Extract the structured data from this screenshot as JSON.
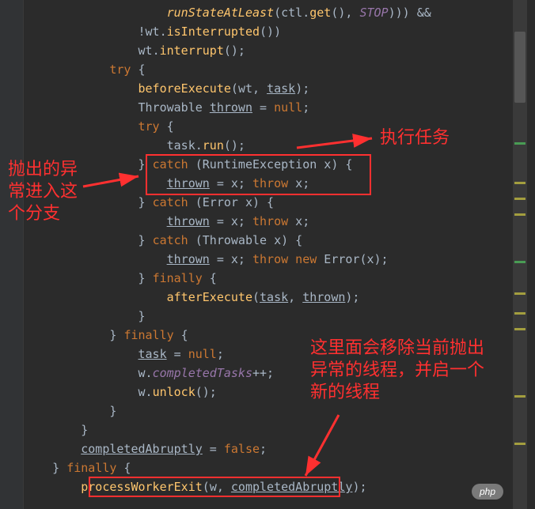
{
  "code": {
    "l0": "                    runStateAtLeast(ctl.get(), STOP))) &&",
    "l1": "                !wt.isInterrupted())",
    "l2": "                wt.interrupt();",
    "l3": "            try {",
    "l4": "                beforeExecute(wt, task);",
    "l5": "                Throwable thrown = null;",
    "l6": "                try {",
    "l7": "                    task.run();",
    "l8": "                } catch (RuntimeException x) {",
    "l9": "                    thrown = x; throw x;",
    "l10": "                } catch (Error x) {",
    "l11": "                    thrown = x; throw x;",
    "l12": "                } catch (Throwable x) {",
    "l13": "                    thrown = x; throw new Error(x);",
    "l14": "                } finally {",
    "l15": "                    afterExecute(task, thrown);",
    "l16": "                }",
    "l17": "            } finally {",
    "l18": "                task = null;",
    "l19": "                w.completedTasks++;",
    "l20": "                w.unlock();",
    "l21": "            }",
    "l22": "        }",
    "l23": "        completedAbruptly = false;",
    "l24": "    } finally {",
    "l25": "        processWorkerExit(w, completedAbruptly);"
  },
  "annotations": {
    "left": "抛出的异常进入这个分支",
    "topRight": "执行任务",
    "bottomRight": "这里面会移除当前抛出异常的线程，并启一个新的线程"
  },
  "badge": "php"
}
